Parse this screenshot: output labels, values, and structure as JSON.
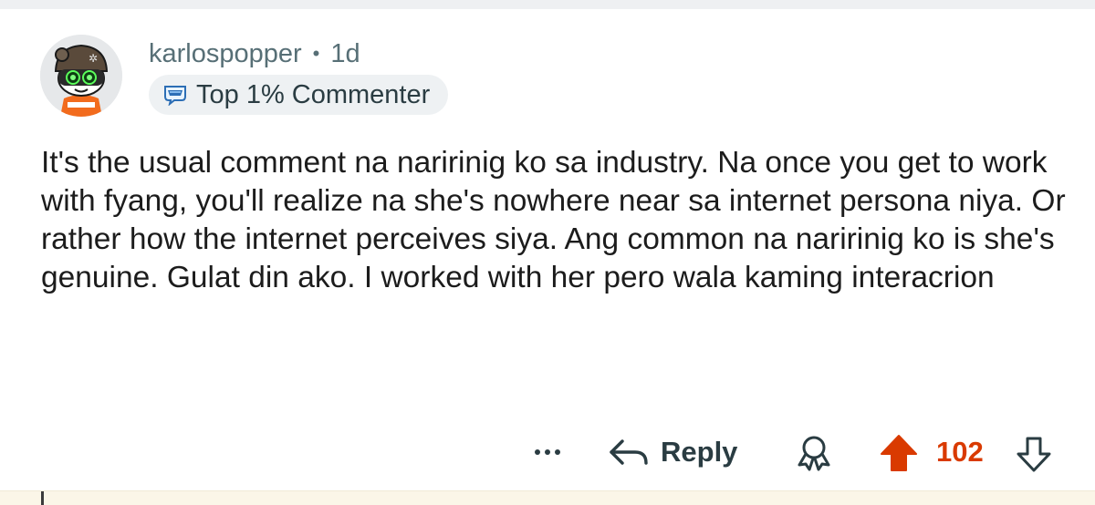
{
  "comment": {
    "author": "karlospopper",
    "separator": "•",
    "time_ago": "1d",
    "flair_icon": "top-commenter-badge-icon",
    "flair_label": "Top 1% Commenter",
    "body": "It's the usual comment na naririnig ko sa industry. Na once you get to work with fyang, you'll realize na she's nowhere near sa internet persona niya. Or rather how the internet perceives siya. Ang common na naririnig ko is she's genuine. Gulat din ako. I worked with her pero wala kaming interacrion"
  },
  "actions": {
    "more_icon": "ellipsis-icon",
    "reply_icon": "reply-arrow-icon",
    "reply_label": "Reply",
    "award_icon": "award-icon",
    "upvote_icon": "upvote-arrow-icon",
    "vote_count": "102",
    "downvote_icon": "downvote-arrow-icon"
  },
  "colors": {
    "upvote_active": "#d93a00",
    "meta_text": "#576f76",
    "flair_background": "#eef1f3"
  }
}
